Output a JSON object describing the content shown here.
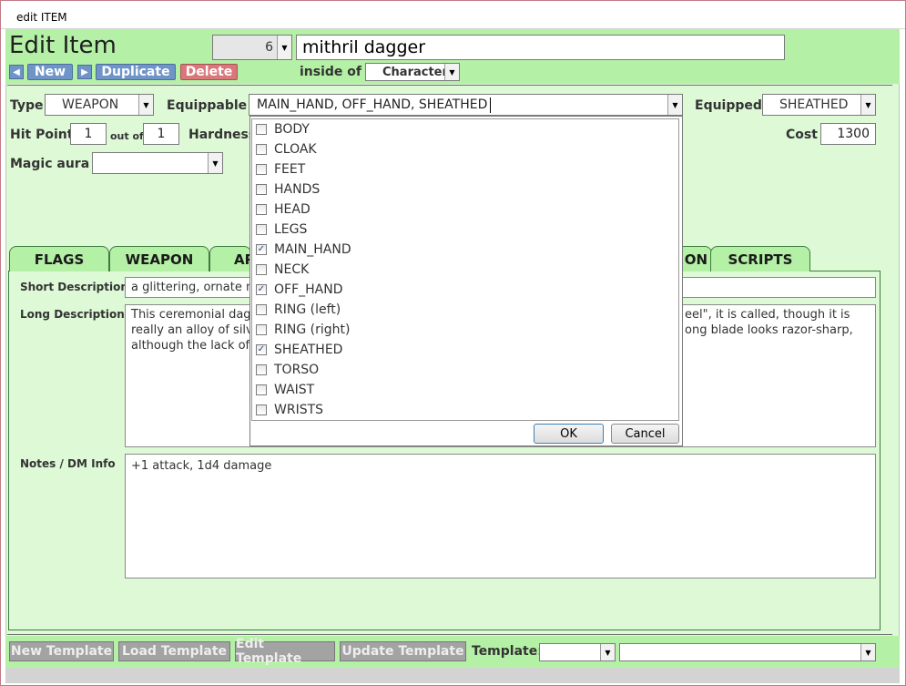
{
  "window": {
    "title": "edit ITEM"
  },
  "header": {
    "heading": "Edit Item",
    "record_number": "6",
    "item_name": "mithril dagger",
    "inside_of_label": "inside of",
    "inside_of_value": "Character",
    "buttons": {
      "new": "New",
      "duplicate": "Duplicate",
      "delete": "Delete"
    }
  },
  "fields": {
    "type_label": "Type",
    "type_value": "WEAPON",
    "equippable_label": "Equippable",
    "equippable_value": "MAIN_HAND, OFF_HAND, SHEATHED",
    "equipped_label": "Equipped",
    "equipped_value": "SHEATHED",
    "hit_points_label": "Hit Points",
    "hit_points_value": "1",
    "out_of_label": "out of",
    "hit_points_max": "1",
    "hardness_label": "Hardness",
    "cost_label": "Cost",
    "cost_value": "1300",
    "magic_aura_label": "Magic aura",
    "magic_aura_value": ""
  },
  "tabs": [
    {
      "label": "FLAGS"
    },
    {
      "label": "WEAPON"
    },
    {
      "label": "AR"
    },
    {
      "label": "ON"
    },
    {
      "label": "SCRIPTS"
    }
  ],
  "description": {
    "short_label": "Short Description",
    "short_left": "a glittering, ornate m",
    "long_label": "Long Description",
    "long_left": [
      "This ceremonial dagg",
      "really an alloy of silve",
      "although the lack of"
    ],
    "long_right": [
      "eel\", it is called, though it is",
      "ong blade looks razor-sharp,"
    ],
    "notes_label": "Notes / DM Info",
    "notes_value": "+1 attack, 1d4 damage"
  },
  "equippable_options": [
    {
      "label": "BODY",
      "checked": false
    },
    {
      "label": "CLOAK",
      "checked": false
    },
    {
      "label": "FEET",
      "checked": false
    },
    {
      "label": "HANDS",
      "checked": false
    },
    {
      "label": "HEAD",
      "checked": false
    },
    {
      "label": "LEGS",
      "checked": false
    },
    {
      "label": "MAIN_HAND",
      "checked": true
    },
    {
      "label": "NECK",
      "checked": false
    },
    {
      "label": "OFF_HAND",
      "checked": true
    },
    {
      "label": "RING (left)",
      "checked": false
    },
    {
      "label": "RING (right)",
      "checked": false
    },
    {
      "label": "SHEATHED",
      "checked": true
    },
    {
      "label": "TORSO",
      "checked": false
    },
    {
      "label": "WAIST",
      "checked": false
    },
    {
      "label": "WRISTS",
      "checked": false
    }
  ],
  "popup_buttons": {
    "ok": "OK",
    "cancel": "Cancel"
  },
  "footer": {
    "new_template": "New Template",
    "load_template": "Load Template",
    "edit_template": "Edit Template",
    "update_template": "Update Template",
    "template_label": "Template:",
    "template_value": "",
    "template_name": ""
  },
  "icons": {
    "dropdown": "chevron-down-icon",
    "prev": "arrow-left-icon",
    "next": "arrow-right-icon",
    "check": "checkmark-icon"
  },
  "colors": {
    "header_green": "#b4f0a5",
    "form_green": "#ddf9d6",
    "nav_blue": "#6f94c8",
    "delete_red": "#d9777a",
    "template_gray": "#a3a3a3"
  }
}
